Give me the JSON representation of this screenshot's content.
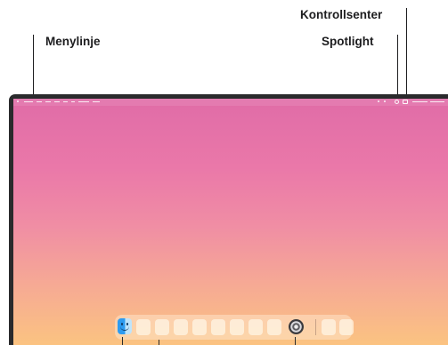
{
  "callouts": {
    "menubar": "Menylinje",
    "spotlight": "Spotlight",
    "control_centre": "Kontrollsenter"
  },
  "icons": {
    "finder": "finder-icon",
    "system_settings": "system-settings-icon",
    "spotlight": "magnifying-glass-icon",
    "control_centre": "control-centre-icon"
  },
  "colors": {
    "wallpaper_top": "#e06ca7",
    "wallpaper_bottom": "#fbc381",
    "frame": "#2a2a2c",
    "label_text": "#1d1d1f"
  },
  "dock": {
    "placeholder_app_count_before_settings": 9,
    "placeholder_app_count_after_divider": 2
  }
}
